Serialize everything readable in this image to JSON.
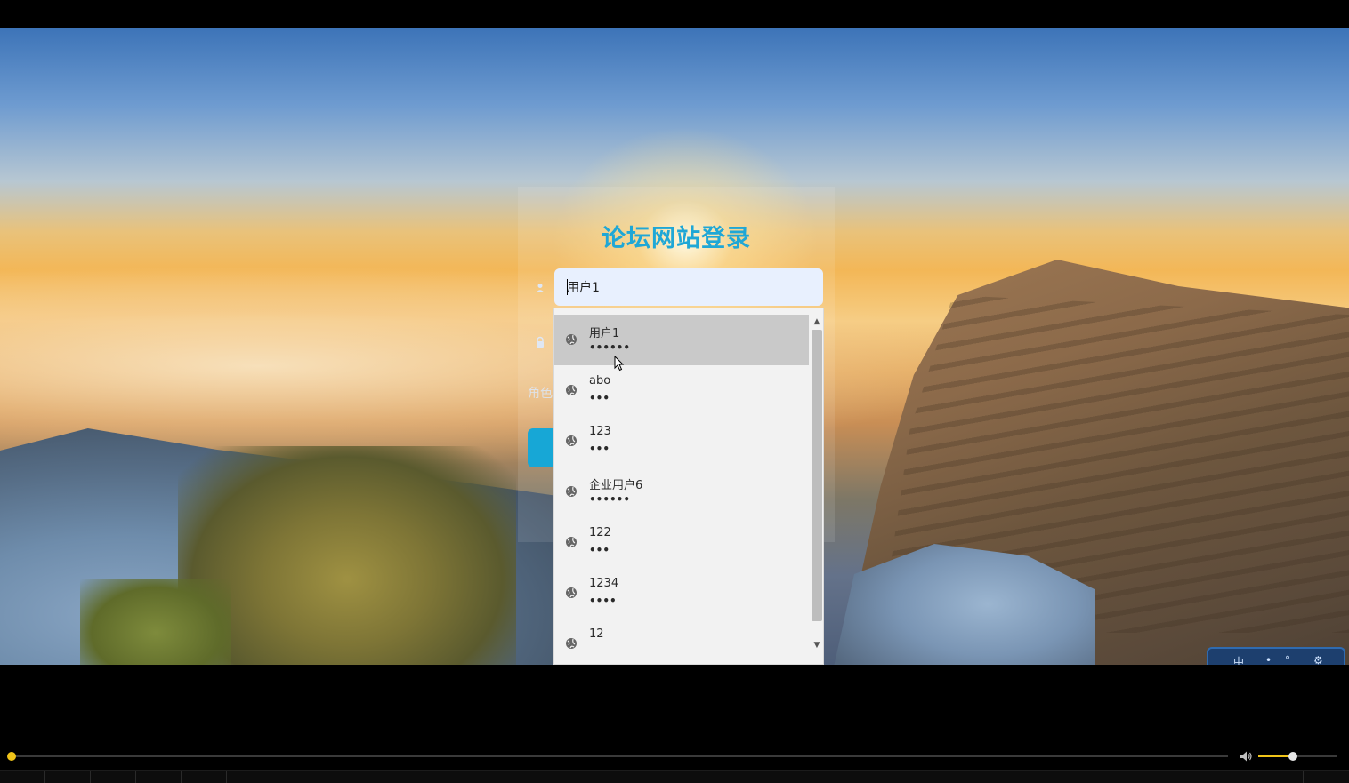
{
  "login": {
    "title": "论坛网站登录",
    "username_value": "用户1",
    "role_label": "角色"
  },
  "autocomplete": {
    "items": [
      {
        "username": "用户1",
        "password_mask": "••••••",
        "highlighted": true
      },
      {
        "username": "abo",
        "password_mask": "•••",
        "highlighted": false
      },
      {
        "username": "123",
        "password_mask": "•••",
        "highlighted": false
      },
      {
        "username": "企业用户6",
        "password_mask": "••••••",
        "highlighted": false
      },
      {
        "username": "122",
        "password_mask": "•••",
        "highlighted": false
      },
      {
        "username": "1234",
        "password_mask": "••••",
        "highlighted": false
      },
      {
        "username": "12",
        "password_mask": "",
        "highlighted": false
      }
    ]
  },
  "ime_toolbar": {
    "chars": [
      "中",
      "•",
      "°",
      "⚙"
    ]
  },
  "player": {
    "seek_progress": 0.0,
    "volume_level": 0.45
  },
  "colors": {
    "title_accent": "#1fa7d6",
    "seek_accent": "#f0c419"
  }
}
